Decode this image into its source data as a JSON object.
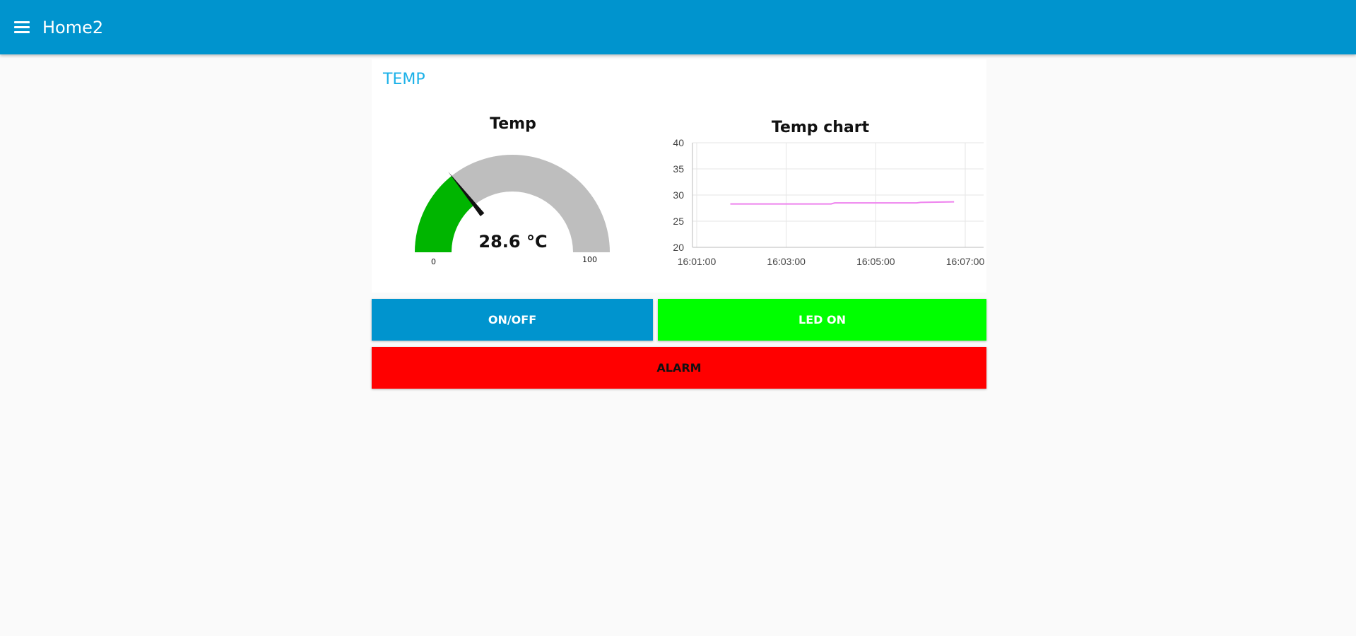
{
  "header": {
    "title": "Home2",
    "menu_icon": "hamburger-menu-icon"
  },
  "group": {
    "title": "TEMP"
  },
  "gauge": {
    "title": "Temp",
    "value": 28.6,
    "value_label": "28.6 °C",
    "min": "0",
    "max": "100",
    "fill_color": "#00b500",
    "track_color": "#bebebe"
  },
  "chart_data": {
    "type": "line",
    "title": "Temp chart",
    "xlabel": "",
    "ylabel": "",
    "ylim": [
      20,
      40
    ],
    "yticks": [
      "20",
      "25",
      "30",
      "35",
      "40"
    ],
    "xticks": [
      "16:01:00",
      "16:03:00",
      "16:05:00",
      "16:07:00"
    ],
    "grid": true,
    "series": [
      {
        "color": "#ee82ee",
        "points": [
          [
            "16:01:45",
            28.3
          ],
          [
            "16:04:00",
            28.3
          ],
          [
            "16:04:05",
            28.5
          ],
          [
            "16:05:55",
            28.5
          ],
          [
            "16:06:00",
            28.6
          ],
          [
            "16:06:45",
            28.7
          ]
        ]
      }
    ]
  },
  "buttons": {
    "onoff": {
      "label": "ON/OFF",
      "color": "#0094ce"
    },
    "led": {
      "label": "LED ON",
      "color": "#00ff00"
    },
    "alarm": {
      "label": "ALARM",
      "color": "#ff0000"
    }
  }
}
